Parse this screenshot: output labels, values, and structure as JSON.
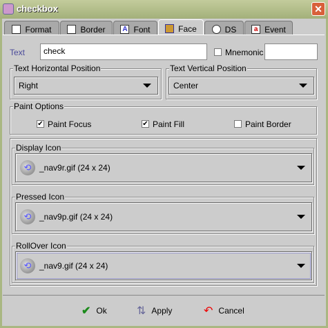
{
  "window": {
    "title": "checkbox",
    "close": "✕"
  },
  "tabs": [
    {
      "label": "Format",
      "icon": "format-icon"
    },
    {
      "label": "Border",
      "icon": "border-icon"
    },
    {
      "label": "Font",
      "icon": "font-icon"
    },
    {
      "label": "Face",
      "icon": "face-icon",
      "active": true
    },
    {
      "label": "DS",
      "icon": "ds-icon"
    },
    {
      "label": "Event",
      "icon": "event-icon"
    }
  ],
  "face": {
    "text_label": "Text",
    "text_value": "check",
    "mnemonic_label": "Mnemonic",
    "mnemonic_checked": false,
    "mnemonic_value": "",
    "hpos_label": "Text Horizontal Position",
    "hpos_value": "Right",
    "vpos_label": "Text Vertical Position",
    "vpos_value": "Center",
    "paint_label": "Paint Options",
    "paint_focus": {
      "label": "Paint Focus",
      "checked": true
    },
    "paint_fill": {
      "label": "Paint Fill",
      "checked": true
    },
    "paint_border": {
      "label": "Paint Border",
      "checked": false
    },
    "display_icon": {
      "label": "Display Icon",
      "value": "_nav9r.gif  (24 x 24)"
    },
    "pressed_icon": {
      "label": "Pressed Icon",
      "value": "_nav9p.gif  (24 x 24)"
    },
    "rollover_icon": {
      "label": "RollOver Icon",
      "value": "_nav9.gif  (24 x 24)"
    }
  },
  "buttons": {
    "ok": "Ok",
    "apply": "Apply",
    "cancel": "Cancel"
  },
  "colors": {
    "title_bar": "#a9b782",
    "panel": "#cccccc",
    "text_label": "#4a4a9a"
  }
}
